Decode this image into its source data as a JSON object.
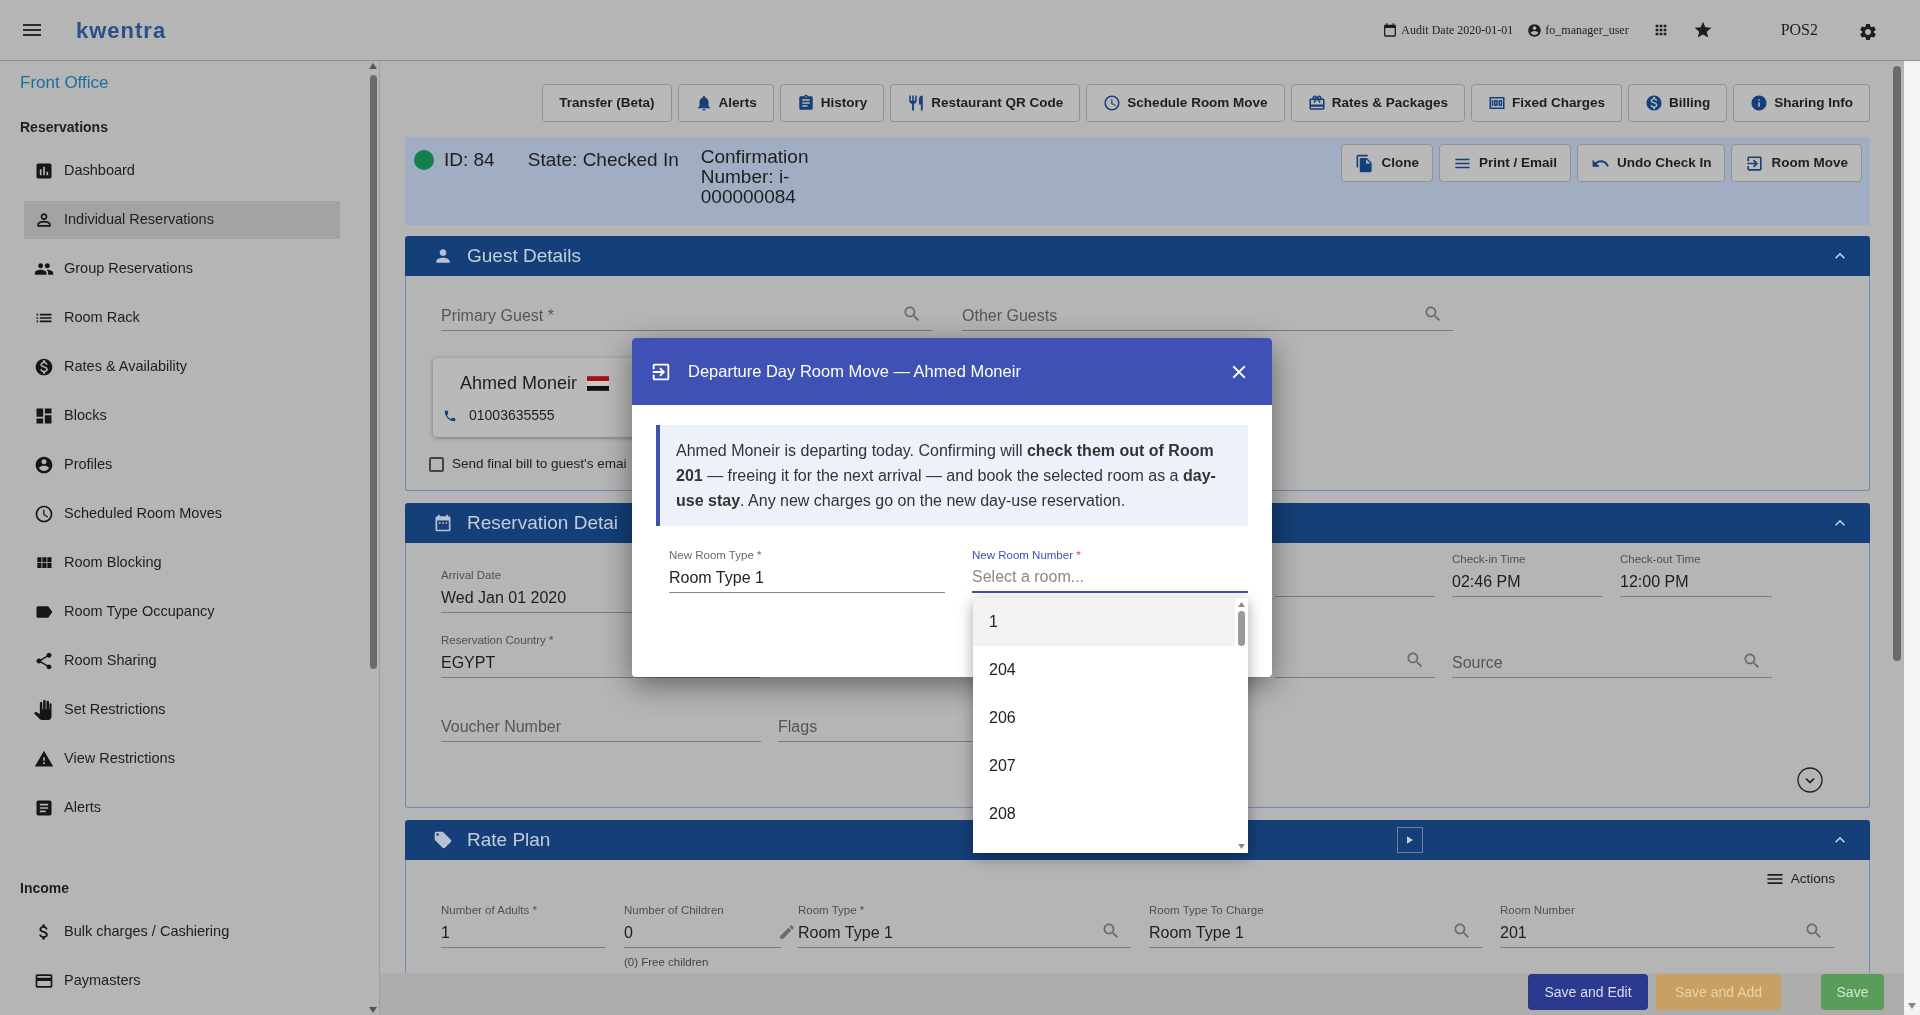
{
  "topbar": {
    "logo": "kwentra",
    "audit_date": "Audit Date 2020-01-01",
    "user": "fo_manager_user",
    "pos": "POS2"
  },
  "sidebar": {
    "title": "Front Office",
    "groups": [
      {
        "heading": "Reservations",
        "items": [
          {
            "label": "Dashboard",
            "selected": false
          },
          {
            "label": "Individual Reservations",
            "selected": true
          },
          {
            "label": "Group Reservations",
            "selected": false
          },
          {
            "label": "Room Rack",
            "selected": false
          },
          {
            "label": "Rates & Availability",
            "selected": false
          },
          {
            "label": "Blocks",
            "selected": false
          },
          {
            "label": "Profiles",
            "selected": false
          },
          {
            "label": "Scheduled Room Moves",
            "selected": false
          },
          {
            "label": "Room Blocking",
            "selected": false
          },
          {
            "label": "Room Type Occupancy",
            "selected": false
          },
          {
            "label": "Room Sharing",
            "selected": false
          },
          {
            "label": "Set Restrictions",
            "selected": false
          },
          {
            "label": "View Restrictions",
            "selected": false
          },
          {
            "label": "Alerts",
            "selected": false
          }
        ]
      },
      {
        "heading": "Income",
        "items": [
          {
            "label": "Bulk charges / Cashiering",
            "selected": false
          },
          {
            "label": "Paymasters",
            "selected": false
          }
        ]
      }
    ]
  },
  "toolbar": [
    "Transfer (Beta)",
    "Alerts",
    "History",
    "Restaurant QR Code",
    "Schedule Room Move",
    "Rates & Packages",
    "Fixed Charges",
    "Billing",
    "Sharing Info"
  ],
  "reservation": {
    "id": "ID: 84",
    "state": "State: Checked In",
    "confirmation": "Confirmation Number: i-000000084",
    "actions": [
      "Clone",
      "Print / Email",
      "Undo Check In",
      "Room Move"
    ]
  },
  "guest_details": {
    "title": "Guest Details",
    "expanded": true,
    "primary_guest": {
      "placeholder": "Primary Guest *"
    },
    "other_guests": {
      "placeholder": "Other Guests"
    },
    "guest": {
      "name": "Ahmed Moneir",
      "phone": "01003635555"
    },
    "send_bill": {
      "label": "Send final bill to guest's emai",
      "checked": false
    }
  },
  "reservation_details": {
    "title": "Reservation Detai",
    "expanded": true,
    "arrival_date": {
      "label": "Arrival Date",
      "value": "Wed Jan 01 2020"
    },
    "check_in_time": {
      "label": "Check-in Time",
      "value": "02:46 PM"
    },
    "check_out_time": {
      "label": "Check-out Time",
      "value": "12:00 PM"
    },
    "reservation_country": {
      "label": "Reservation Country *",
      "value": "EGYPT"
    },
    "source": {
      "placeholder": "Source"
    },
    "voucher_number": {
      "placeholder": "Voucher Number"
    },
    "flags": {
      "placeholder": "Flags"
    }
  },
  "rate_plan": {
    "title": "Rate Plan",
    "expanded": true,
    "actions": "Actions",
    "fields": [
      {
        "label": "Number of Adults *",
        "value": "1"
      },
      {
        "label": "Number of Children",
        "value": "0",
        "hint": "(0) Free children"
      },
      {
        "label": "Room Type *",
        "value": "Room Type 1"
      },
      {
        "label": "Room Type To Charge",
        "value": "Room Type 1"
      },
      {
        "label": "Room Number",
        "value": "201"
      }
    ]
  },
  "footer_buttons": [
    {
      "label": "Save and Edit",
      "kind": "primary"
    },
    {
      "label": "Save and Add",
      "kind": "warning"
    },
    {
      "label": "Save",
      "kind": "success"
    }
  ],
  "dialog": {
    "title": "Departure Day Room Move — Ahmed Moneir",
    "message": "Ahmed Moneir is departing today. Confirming will **check them out of Room 201** — freeing it for the next arrival — and book the selected room as a **day-use stay**. Any new charges go on the new day-use reservation.",
    "room_type": {
      "label": "New Room Type *",
      "value": "Room Type 1"
    },
    "room_number": {
      "label": "New Room Number",
      "required_mark": "*",
      "placeholder": "Select a room...",
      "focused": true
    },
    "options": [
      {
        "label": "1",
        "selected": true
      },
      {
        "label": "204",
        "selected": false
      },
      {
        "label": "206",
        "selected": false
      },
      {
        "label": "207",
        "selected": false
      },
      {
        "label": "208",
        "selected": false
      }
    ]
  }
}
